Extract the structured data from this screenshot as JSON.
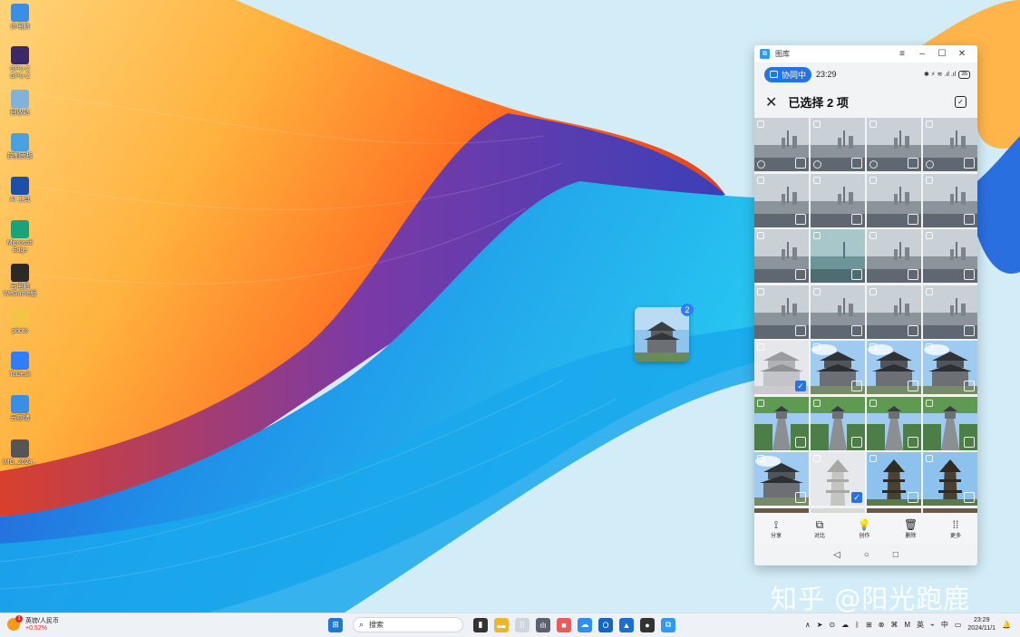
{
  "desktop": {
    "icons": [
      {
        "label": "此电脑",
        "icon": "computer-icon",
        "color": "#3a8ee6"
      },
      {
        "label": "GPU-Z\nGPU-Z",
        "icon": "gpu-icon",
        "color": "#3c2a66"
      },
      {
        "label": "回收站",
        "icon": "recycle-bin-icon",
        "color": "#7fb3d8"
      },
      {
        "label": "控制面板",
        "icon": "control-panel-icon",
        "color": "#4aa0e0"
      },
      {
        "label": "AI 工具",
        "icon": "ai-icon",
        "color": "#1c4fa8"
      },
      {
        "label": "Microsoft\nEdge",
        "icon": "edge-icon",
        "color": "#1aa37a"
      },
      {
        "label": "云电脑\nWeGame版",
        "icon": "game-icon",
        "color": "#2a2a2a"
      },
      {
        "label": "photo",
        "icon": "folder-icon",
        "color": "#f4c445"
      },
      {
        "label": "ToDesk",
        "icon": "todesk-icon",
        "color": "#2f7ef5"
      },
      {
        "label": "云存储",
        "icon": "cloud-icon",
        "color": "#3a8ee6"
      },
      {
        "label": "IMG_2024...",
        "icon": "image-file-icon",
        "color": "#555555"
      }
    ]
  },
  "drag": {
    "count": "2"
  },
  "phone_window": {
    "title": "图库 ",
    "controls": {
      "menu": "≡",
      "minimize": "–",
      "maximize": "☐",
      "close": "✕"
    },
    "status": {
      "collab": "协同中",
      "time": "23:29",
      "signal": "✱ ⚡ ≋ .ıl .ıl",
      "battery": "35"
    },
    "selection": {
      "title": "已选择 2 项",
      "close": "✕"
    },
    "grid_rows": [
      [
        "cityfog",
        "cityfog",
        "cityfog",
        "cityfog"
      ],
      [
        "cityfog",
        "cityfog",
        "cityfog",
        "cityfog"
      ],
      [
        "cityfog",
        "cityteal",
        "cityfog",
        "cityfog"
      ],
      [
        "cityfog",
        "cityfog",
        "cityfog",
        "cityfog"
      ],
      [
        "pavilionpale",
        "pavilion",
        "pavilion",
        "pavilion"
      ],
      [
        "steps",
        "steps",
        "steps",
        "steps"
      ],
      [
        "pavilion",
        "pagodapale",
        "pagoda",
        "pagoda"
      ]
    ],
    "checked_cells": [
      "4-0",
      "6-1"
    ],
    "toolbar": [
      {
        "label": "分享",
        "icon": "share-icon",
        "glyph": "⟟"
      },
      {
        "label": "对比",
        "icon": "compare-icon",
        "glyph": "⧉"
      },
      {
        "label": "创作",
        "icon": "bulb-icon",
        "glyph": "💡"
      },
      {
        "label": "删除",
        "icon": "trash-icon",
        "glyph": "🗑"
      },
      {
        "label": "更多",
        "icon": "more-icon",
        "glyph": "⁞⁞"
      }
    ],
    "nav": {
      "back": "◁",
      "home": "○",
      "recent": "□"
    }
  },
  "watermark": "知乎 @阳光跑鹿",
  "taskbar": {
    "news": {
      "badge": "1",
      "title": "英镑/人民币",
      "change": "+0.52%"
    },
    "search_placeholder": "搜索",
    "apps": [
      {
        "name": "start-icon",
        "glyph": "⊞",
        "color": "#1e78d6"
      },
      {
        "name": "task-view-icon",
        "glyph": "▮",
        "color": "#333333"
      },
      {
        "name": "file-explorer-icon",
        "glyph": "▬",
        "color": "#f0b429"
      },
      {
        "name": "notepad-icon",
        "glyph": "▯",
        "color": "#cfd6de"
      },
      {
        "name": "stats-icon",
        "glyph": "ılı",
        "color": "#5a6270"
      },
      {
        "name": "red-app-icon",
        "glyph": "■",
        "color": "#ec5a5a"
      },
      {
        "name": "cloud-app-icon",
        "glyph": "☁",
        "color": "#2f8ef0"
      },
      {
        "name": "outlook-icon",
        "glyph": "O",
        "color": "#1167c5"
      },
      {
        "name": "photos-icon",
        "glyph": "▲",
        "color": "#1b6fd1"
      },
      {
        "name": "camera-icon",
        "glyph": "●",
        "color": "#333333"
      },
      {
        "name": "collab-app-icon",
        "glyph": "⧉",
        "color": "#2f9bf0"
      }
    ],
    "tray_symbols": [
      "∧",
      "➤",
      "⊙",
      "☁",
      "ᛒ",
      "⊞",
      "⊗",
      "⌘",
      "M",
      "英",
      "⌁",
      "中",
      "▭"
    ],
    "clock_time": "23:29",
    "clock_date": "2024/11/1",
    "bell": "🔔"
  }
}
